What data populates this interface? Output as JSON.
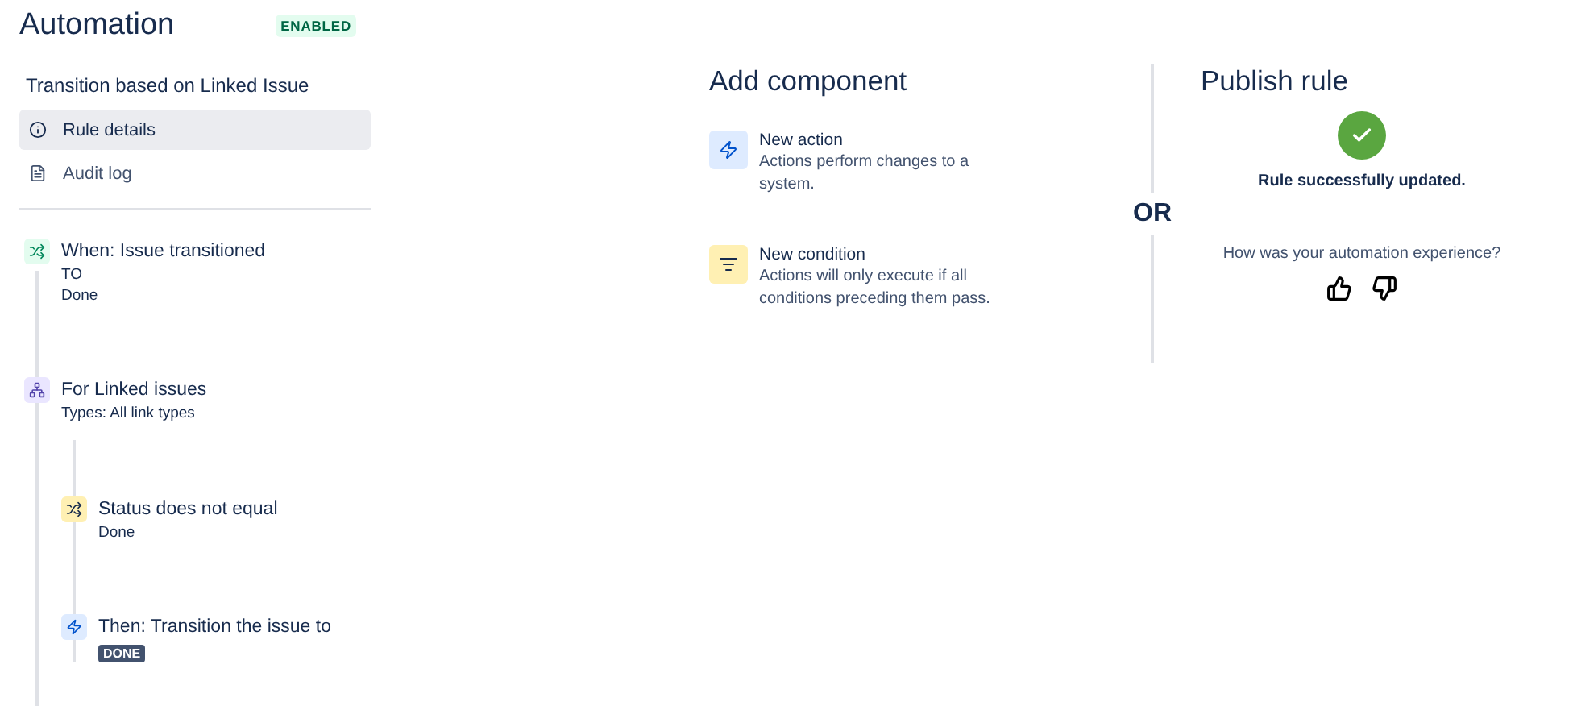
{
  "header": {
    "title": "Automation",
    "status": "ENABLED"
  },
  "rule_name": "Transition based on Linked Issue",
  "nav": [
    {
      "label": "Rule details",
      "kind": "info",
      "selected": true
    },
    {
      "label": "Audit log",
      "kind": "log",
      "selected": false
    }
  ],
  "steps": [
    {
      "kind": "trigger",
      "title": "When: Issue transitioned",
      "lines": [
        "TO",
        "Done"
      ]
    },
    {
      "kind": "branch",
      "title": "For Linked issues",
      "lines": [
        "Types: All link types"
      ],
      "children": [
        {
          "kind": "condition",
          "title": "Status does not equal",
          "lines": [
            "Done"
          ]
        },
        {
          "kind": "action",
          "title": "Then: Transition the issue to",
          "lozenge": "DONE"
        }
      ]
    }
  ],
  "add_component": {
    "title": "Add component",
    "options": [
      {
        "kind": "action",
        "title": "New action",
        "description": "Actions perform changes to a system."
      },
      {
        "kind": "condition",
        "title": "New condition",
        "description": "Actions will only execute if all conditions preceding them pass."
      }
    ]
  },
  "divider_label": "OR",
  "publish": {
    "title": "Publish rule",
    "message": "Rule successfully updated.",
    "feedback_prompt": "How was your automation experience?"
  }
}
